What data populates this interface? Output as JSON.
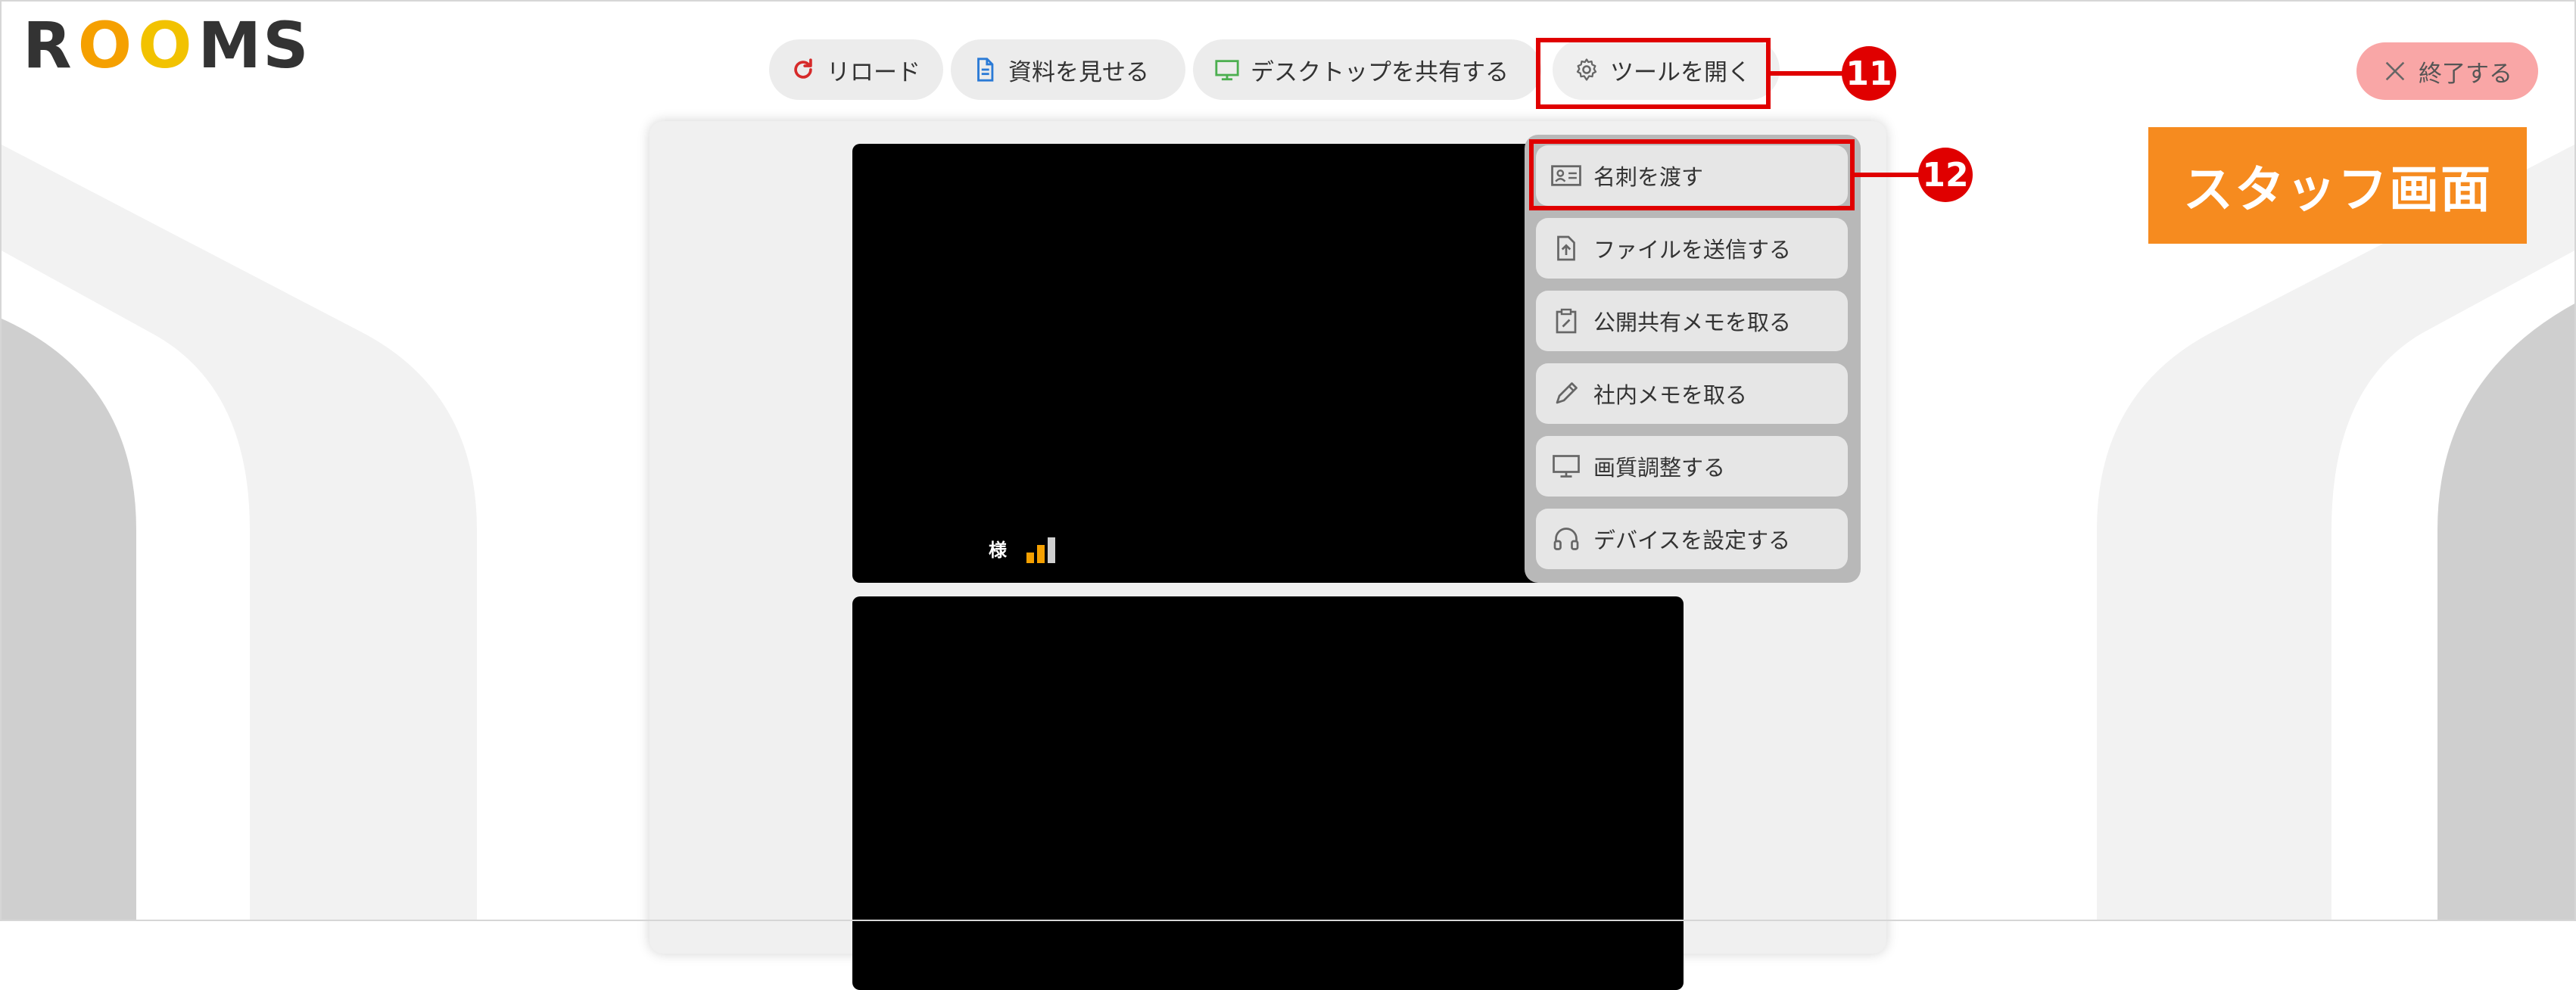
{
  "app": {
    "logo_parts": [
      "R",
      "O",
      "O",
      "MS"
    ]
  },
  "toolbar": {
    "reload_label": "リロード",
    "docs_label": "資料を見せる",
    "desktop_label": "デスクトップを共有する",
    "tools_label": "ツールを開く"
  },
  "end_button": {
    "label": "終了する"
  },
  "staff_label": "スタッフ画面",
  "callouts": {
    "first": "11",
    "second": "12"
  },
  "video": {
    "participant_suffix": "様",
    "signal_level": 2,
    "signal_max": 3
  },
  "tools_menu": {
    "items": [
      {
        "label": "名刺を渡す",
        "icon": "business-card-icon"
      },
      {
        "label": "ファイルを送信する",
        "icon": "file-upload-icon"
      },
      {
        "label": "公開共有メモを取る",
        "icon": "clipboard-memo-icon"
      },
      {
        "label": "社内メモを取る",
        "icon": "pencil-icon"
      },
      {
        "label": "画質調整する",
        "icon": "monitor-icon"
      },
      {
        "label": "デバイスを設定する",
        "icon": "headset-icon"
      }
    ]
  },
  "colors": {
    "accent_orange": "#f68b1f",
    "annotation_red": "#e00000",
    "end_button_pink": "#f9a6a6",
    "reload_icon": "#d62a2a",
    "docs_icon": "#2a7ad6",
    "desktop_icon": "#4caf50"
  }
}
